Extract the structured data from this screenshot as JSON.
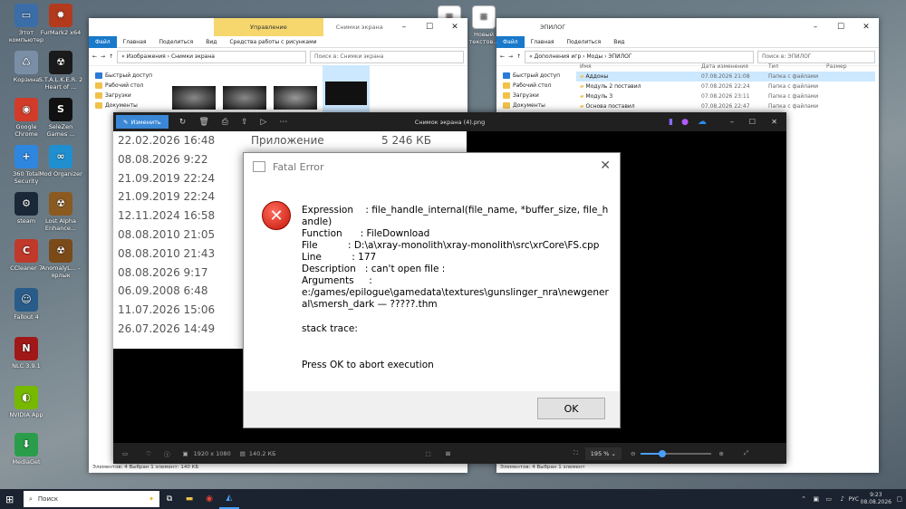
{
  "desktop_icons": [
    {
      "label": "Этот компьютер",
      "name": "this-pc-icon",
      "color": "#3b6ea8",
      "glyph": "▭"
    },
    {
      "label": "FurMark2 x64",
      "name": "furmark-icon",
      "color": "#b33a1c",
      "glyph": "✹"
    },
    {
      "label": "Корзина",
      "name": "recycle-bin-icon",
      "color": "#7a8fa6",
      "glyph": "♺"
    },
    {
      "label": "S.T.A.L.K.E.R. 2 Heart of ...",
      "name": "stalker2-icon",
      "color": "#1a1a1a",
      "glyph": "☢"
    },
    {
      "label": "Google Chrome",
      "name": "chrome-icon",
      "color": "#d23b2a",
      "glyph": "◉"
    },
    {
      "label": "SeleZen Games ...",
      "name": "selezen-icon",
      "color": "#111111",
      "glyph": "S"
    },
    {
      "label": "360 Total Security",
      "name": "360-security-icon",
      "color": "#2e86de",
      "glyph": "+"
    },
    {
      "label": "Mod Organizer",
      "name": "mod-organizer-icon",
      "color": "#1f8fd0",
      "glyph": "∞"
    },
    {
      "label": "steam",
      "name": "steam-icon",
      "color": "#1b2838",
      "glyph": "⚙"
    },
    {
      "label": "Lost Alpha Enhance...",
      "name": "lost-alpha-icon",
      "color": "#8a5a20",
      "glyph": "☢"
    },
    {
      "label": "CCleaner 7",
      "name": "ccleaner-icon",
      "color": "#c0392b",
      "glyph": "C"
    },
    {
      "label": "AnomalyL... - ярлык",
      "name": "anomaly-icon",
      "color": "#7a4a18",
      "glyph": "☢"
    },
    {
      "label": "Fallout 4",
      "name": "fallout4-icon",
      "color": "#2a5c8a",
      "glyph": "☺"
    },
    {
      "label": "NLC 3.9.1",
      "name": "nlc-icon",
      "color": "#a01818",
      "glyph": "N"
    },
    {
      "label": "NVIDIA App",
      "name": "nvidia-icon",
      "color": "#76b900",
      "glyph": "◐"
    },
    {
      "label": "MediaGet",
      "name": "mediaget-icon",
      "color": "#2a9d4a",
      "glyph": "⬇"
    }
  ],
  "side_icons": [
    {
      "label": "Новый текстов...",
      "name": "new-text-file-icon"
    }
  ],
  "explorer_left": {
    "tab_management": "Управление",
    "title": "Снимки экрана",
    "ribbon": [
      "Файл",
      "Главная",
      "Поделиться",
      "Вид",
      "Средства работы с рисунками"
    ],
    "path": "« Изображения › Снимки экрана",
    "search": "Поиск в: Снимки экрана",
    "nav": [
      "Быстрый доступ",
      "Рабочий стол",
      "Загрузки",
      "Документы"
    ],
    "status": "Элементов: 4     Выбран 1 элемент: 140 КБ"
  },
  "explorer_right": {
    "title": "ЭПИЛОГ",
    "ribbon": [
      "Файл",
      "Главная",
      "Поделиться",
      "Вид"
    ],
    "path": "« Дополнения игр › Моды › ЭПИЛОГ",
    "search": "Поиск в: ЭПИЛОГ",
    "nav": [
      "Быстрый доступ",
      "Рабочий стол",
      "Загрузки",
      "Документы"
    ],
    "columns": [
      "Имя",
      "Дата изменения",
      "Тип",
      "Размер"
    ],
    "rows": [
      {
        "name": "Аддоны",
        "date": "07.08.2026 21:08",
        "type": "Папка с файлами"
      },
      {
        "name": "Модуль 2 поставил",
        "date": "07.08.2026 22:24",
        "type": "Папка с файлами"
      },
      {
        "name": "Модуль 3",
        "date": "07.08.2026 23:11",
        "type": "Папка с файлами"
      },
      {
        "name": "Основа поставил",
        "date": "07.08.2026 22:47",
        "type": "Папка с файлами"
      }
    ],
    "status": "Элементов: 4     Выбран 1 элемент"
  },
  "viewer": {
    "edit_label": "Изменить",
    "title": "Снимок экрана (4).png",
    "resolution": "1920 x 1080",
    "size": "140.2 КБ",
    "zoom": "195 %",
    "zoom_level": 0.3
  },
  "dates": [
    "22.02.2026 16:48",
    "08.08.2026 9:22",
    "21.09.2019 22:24",
    "21.09.2019 22:24",
    "12.11.2024 16:58",
    "08.08.2010 21:05",
    "08.08.2010 21:43",
    "08.08.2026 9:17",
    "06.09.2008 6:48",
    "11.07.2026 15:06",
    "26.07.2026 14:49"
  ],
  "app_label": "Приложение",
  "app_size": "5 246 КБ",
  "dialog": {
    "title": "Fatal Error",
    "lines": [
      "Expression    : file_handle_internal(file_name, *buffer_size, file_handle)",
      "Function      : FileDownload",
      "File          : D:\\a\\xray-monolith\\xray-monolith\\src\\xrCore\\FS.cpp",
      "Line          : 177",
      "Description   : can't open file :",
      "Arguments     :",
      "e:/games/epilogue\\gamedata\\textures\\gunslinger_nra\\newgeneral\\smersh_dark — ?????.thm"
    ],
    "stack": "stack trace:",
    "abort": "Press OK to abort execution",
    "ok": "OK"
  },
  "taskbar": {
    "search": "Поиск",
    "lang": "РУС",
    "time": "9:23",
    "date": "08.08.2026"
  }
}
